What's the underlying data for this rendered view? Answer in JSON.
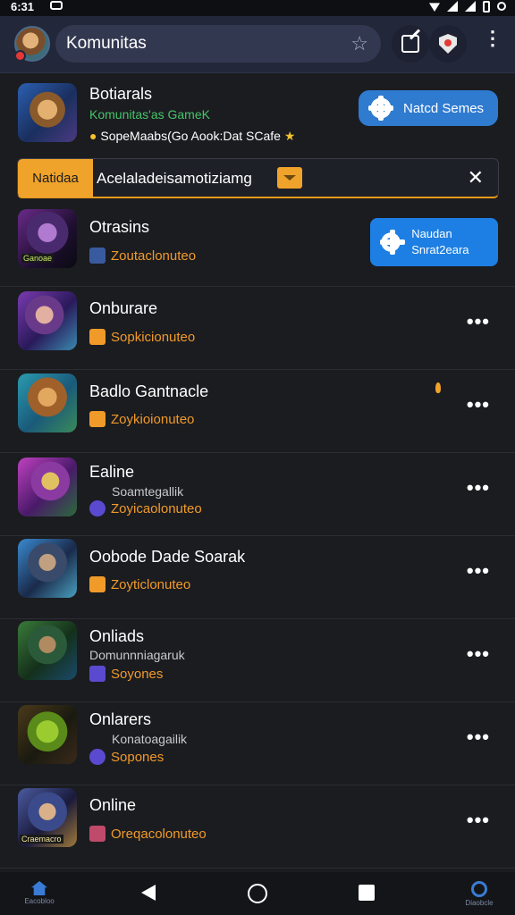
{
  "status_bar": {
    "time": "6:31"
  },
  "header": {
    "search_text": "Komunitas"
  },
  "featured": {
    "title": "Botiarals",
    "subtitle": "Komunitas'as GameK",
    "line": "SopeMaabs(Go Aook:Dat SCafe",
    "button_label": "Natcd Semes"
  },
  "banner": {
    "tag": "Natidaa",
    "text": "Acelaladeisamotiziamg"
  },
  "rows": [
    {
      "title": "Otrasins",
      "meta": "Zoutaclonuteo",
      "button_label": "Naudan Snrat2eara"
    },
    {
      "title": "Onburare",
      "meta": "Sopkicionuteo"
    },
    {
      "title": "Badlo Gantnacle",
      "meta": "Zoykioionuteo"
    },
    {
      "title": "Ealine",
      "sub": "Soamtegallik",
      "meta": "Zoyicaolonuteo"
    },
    {
      "title": "Oobode Dade Soarak",
      "meta": "Zoyticlonuteo"
    },
    {
      "title": "Onliads",
      "sub": "Domunnniagaruk",
      "meta": "Soyones"
    },
    {
      "title": "Onlarers",
      "sub": "Konatoagailik",
      "meta": "Sopones"
    },
    {
      "title": "Online",
      "meta": "Oreqacolonuteo"
    }
  ],
  "thumb_badges": {
    "row0": "Ganoae",
    "row7": "Craemacro"
  },
  "nav": {
    "home_label": "Eacobloo",
    "disc_label": "Diaobcle"
  },
  "colors": {
    "accent_blue": "#1d7fe3",
    "orange": "#f09a2a",
    "green": "#47c46a"
  }
}
